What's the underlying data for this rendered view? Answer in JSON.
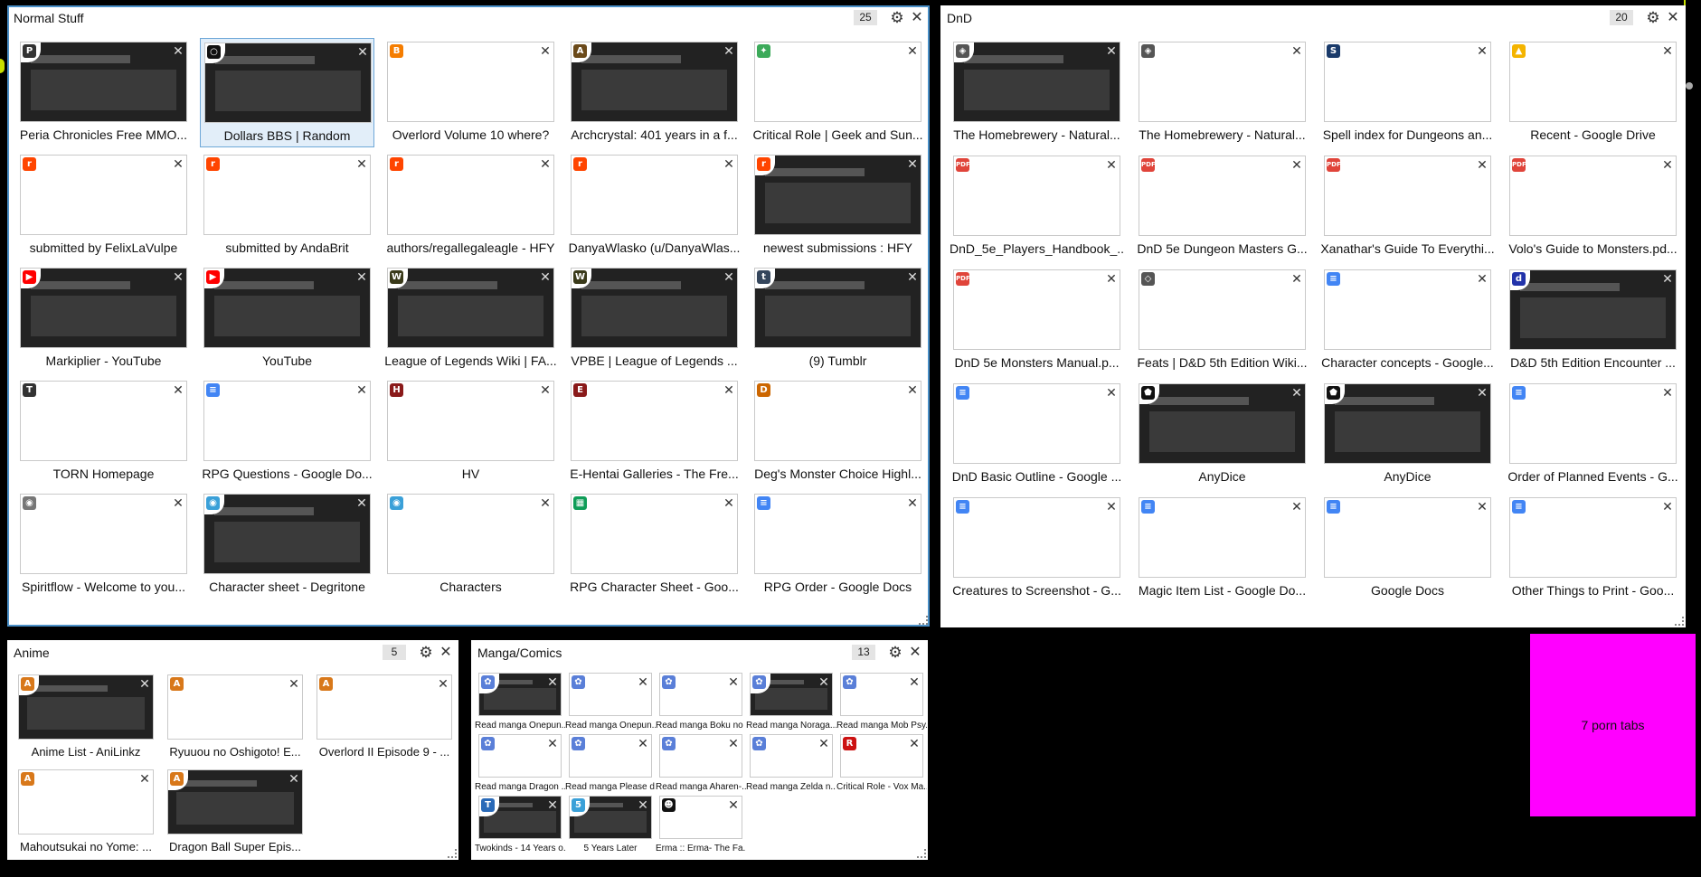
{
  "overflow_label": "7 porn tabs",
  "groups": [
    {
      "key": "normal_stuff",
      "title": "Normal Stuff",
      "count": "25",
      "tabs": [
        {
          "label": "Peria Chronicles Free MMO...",
          "icon": "page-icon",
          "icon_color": "#333333",
          "glyph": "P",
          "dark": true
        },
        {
          "label": "Dollars BBS | Random",
          "icon": "page-icon",
          "icon_color": "#111111",
          "glyph": "○",
          "dark": true,
          "selected": true
        },
        {
          "label": "Overlord Volume 10 where?",
          "icon": "blogger-icon",
          "icon_color": "#f57d00",
          "glyph": "B",
          "dark": false
        },
        {
          "label": "Archcrystal: 401 years in a f...",
          "icon": "page-icon",
          "icon_color": "#6b4a1a",
          "glyph": "A",
          "dark": true
        },
        {
          "label": "Critical Role | Geek and Sun...",
          "icon": "page-icon",
          "icon_color": "#3caa5a",
          "glyph": "✦",
          "dark": false
        },
        {
          "label": "submitted by FelixLaVulpe",
          "icon": "reddit-icon",
          "icon_color": "#ff4500",
          "glyph": "r",
          "dark": false
        },
        {
          "label": "submitted by AndaBrit",
          "icon": "reddit-icon",
          "icon_color": "#ff4500",
          "glyph": "r",
          "dark": false
        },
        {
          "label": "authors/regallegaleagle - HFY",
          "icon": "reddit-icon",
          "icon_color": "#ff4500",
          "glyph": "r",
          "dark": false
        },
        {
          "label": "DanyaWlasko (u/DanyaWlas...",
          "icon": "reddit-icon",
          "icon_color": "#ff4500",
          "glyph": "r",
          "dark": false
        },
        {
          "label": "newest submissions : HFY",
          "icon": "reddit-icon",
          "icon_color": "#ff4500",
          "glyph": "r",
          "dark": true
        },
        {
          "label": "Markiplier - YouTube",
          "icon": "youtube-icon",
          "icon_color": "#ff0000",
          "glyph": "▶",
          "dark": true
        },
        {
          "label": "YouTube",
          "icon": "youtube-icon",
          "icon_color": "#ff0000",
          "glyph": "▶",
          "dark": true
        },
        {
          "label": "League of Legends Wiki | FA...",
          "icon": "wikia-icon",
          "icon_color": "#3a3a1a",
          "glyph": "W",
          "dark": true
        },
        {
          "label": "VPBE | League of Legends ...",
          "icon": "wikia-icon",
          "icon_color": "#3a3a1a",
          "glyph": "W",
          "dark": true
        },
        {
          "label": "(9) Tumblr",
          "icon": "tumblr-icon",
          "icon_color": "#35465c",
          "glyph": "t",
          "dark": true
        },
        {
          "label": "TORN Homepage",
          "icon": "torn-icon",
          "icon_color": "#333333",
          "glyph": "T",
          "dark": false
        },
        {
          "label": "RPG Questions - Google Do...",
          "icon": "google-docs-icon",
          "icon_color": "#4285f4",
          "glyph": "≡",
          "dark": false
        },
        {
          "label": "HV",
          "icon": "page-icon",
          "icon_color": "#8a1a1a",
          "glyph": "H",
          "dark": false
        },
        {
          "label": "E-Hentai Galleries - The Fre...",
          "icon": "page-icon",
          "icon_color": "#8a1a1a",
          "glyph": "E",
          "dark": false
        },
        {
          "label": "Deg's Monster Choice Highl...",
          "icon": "page-icon",
          "icon_color": "#cc6600",
          "glyph": "D",
          "dark": false
        },
        {
          "label": "Spiritflow - Welcome to you...",
          "icon": "chat-icon",
          "icon_color": "#777777",
          "glyph": "◉",
          "dark": false
        },
        {
          "label": "Character sheet - Degritone",
          "icon": "chat-icon",
          "icon_color": "#3aa0d8",
          "glyph": "◉",
          "dark": true
        },
        {
          "label": "Characters",
          "icon": "chat-icon",
          "icon_color": "#3aa0d8",
          "glyph": "◉",
          "dark": false
        },
        {
          "label": "RPG Character Sheet - Goo...",
          "icon": "google-sheets-icon",
          "icon_color": "#0f9d58",
          "glyph": "▦",
          "dark": false
        },
        {
          "label": "RPG Order - Google Docs",
          "icon": "google-docs-icon",
          "icon_color": "#4285f4",
          "glyph": "≡",
          "dark": false
        }
      ]
    },
    {
      "key": "dnd",
      "title": "DnD",
      "count": "20",
      "tabs": [
        {
          "label": "The Homebrewery - Natural...",
          "icon": "d20-icon",
          "icon_color": "#555555",
          "glyph": "◈",
          "dark": true
        },
        {
          "label": "The Homebrewery - Natural...",
          "icon": "d20-icon",
          "icon_color": "#555555",
          "glyph": "◈",
          "dark": false
        },
        {
          "label": "Spell index for Dungeons an...",
          "icon": "page-icon",
          "icon_color": "#1a3a6a",
          "glyph": "S",
          "dark": false
        },
        {
          "label": "Recent - Google Drive",
          "icon": "google-drive-icon",
          "icon_color": "#f4b400",
          "glyph": "▲",
          "dark": false
        },
        {
          "label": "DnD_5e_Players_Handbook_...",
          "icon": "pdf-icon",
          "icon_color": "#e0443a",
          "glyph": "PDF",
          "dark": false
        },
        {
          "label": "DnD 5e Dungeon Masters G...",
          "icon": "pdf-icon",
          "icon_color": "#e0443a",
          "glyph": "PDF",
          "dark": false
        },
        {
          "label": "Xanathar's Guide To Everythi...",
          "icon": "pdf-icon",
          "icon_color": "#e0443a",
          "glyph": "PDF",
          "dark": false
        },
        {
          "label": "Volo's Guide to Monsters.pd...",
          "icon": "pdf-icon",
          "icon_color": "#e0443a",
          "glyph": "PDF",
          "dark": false
        },
        {
          "label": "DnD 5e Monsters Manual.p...",
          "icon": "pdf-icon",
          "icon_color": "#e0443a",
          "glyph": "PDF",
          "dark": false
        },
        {
          "label": "Feats | D&D 5th Edition Wiki...",
          "icon": "page-icon",
          "icon_color": "#555555",
          "glyph": "◇",
          "dark": false
        },
        {
          "label": "Character concepts - Google...",
          "icon": "google-docs-icon",
          "icon_color": "#4285f4",
          "glyph": "≡",
          "dark": false
        },
        {
          "label": "D&D 5th Edition Encounter ...",
          "icon": "page-icon",
          "icon_color": "#2233aa",
          "glyph": "d",
          "dark": true
        },
        {
          "label": "DnD Basic Outline - Google ...",
          "icon": "google-docs-icon",
          "icon_color": "#4285f4",
          "glyph": "≡",
          "dark": false
        },
        {
          "label": "AnyDice",
          "icon": "dice-icon",
          "icon_color": "#111111",
          "glyph": "⬟",
          "dark": true
        },
        {
          "label": "AnyDice",
          "icon": "dice-icon",
          "icon_color": "#111111",
          "glyph": "⬟",
          "dark": true
        },
        {
          "label": "Order of Planned Events - G...",
          "icon": "google-docs-icon",
          "icon_color": "#4285f4",
          "glyph": "≡",
          "dark": false
        },
        {
          "label": "Creatures to Screenshot - G...",
          "icon": "google-docs-icon",
          "icon_color": "#4285f4",
          "glyph": "≡",
          "dark": false
        },
        {
          "label": "Magic Item List - Google Do...",
          "icon": "google-docs-icon",
          "icon_color": "#4285f4",
          "glyph": "≡",
          "dark": false
        },
        {
          "label": "Google Docs",
          "icon": "google-docs-icon",
          "icon_color": "#4285f4",
          "glyph": "≡",
          "dark": false
        },
        {
          "label": "Other Things to Print - Goo...",
          "icon": "google-docs-icon",
          "icon_color": "#4285f4",
          "glyph": "≡",
          "dark": false
        }
      ]
    },
    {
      "key": "anime",
      "title": "Anime",
      "count": "5",
      "tabs": [
        {
          "label": "Anime List - AniLinkz",
          "icon": "anilinkz-icon",
          "icon_color": "#d8781a",
          "glyph": "A",
          "dark": true
        },
        {
          "label": "Ryuuou no Oshigoto! E...",
          "icon": "anilinkz-icon",
          "icon_color": "#d8781a",
          "glyph": "A",
          "dark": false
        },
        {
          "label": "Overlord II Episode 9 - ...",
          "icon": "anilinkz-icon",
          "icon_color": "#d8781a",
          "glyph": "A",
          "dark": false
        },
        {
          "label": "Mahoutsukai no Yome: ...",
          "icon": "anilinkz-icon",
          "icon_color": "#d8781a",
          "glyph": "A",
          "dark": false
        },
        {
          "label": "Dragon Ball Super Epis...",
          "icon": "anilinkz-icon",
          "icon_color": "#d8781a",
          "glyph": "A",
          "dark": true
        }
      ]
    },
    {
      "key": "manga",
      "title": "Manga/Comics",
      "count": "13",
      "tabs": [
        {
          "label": "Read manga Onepun...",
          "icon": "manga-icon",
          "icon_color": "#5a7fd8",
          "glyph": "✿",
          "dark": true
        },
        {
          "label": "Read manga Onepun...",
          "icon": "manga-icon",
          "icon_color": "#5a7fd8",
          "glyph": "✿",
          "dark": false
        },
        {
          "label": "Read manga Boku no ...",
          "icon": "manga-icon",
          "icon_color": "#5a7fd8",
          "glyph": "✿",
          "dark": false
        },
        {
          "label": "Read manga Noraga...",
          "icon": "manga-icon",
          "icon_color": "#5a7fd8",
          "glyph": "✿",
          "dark": true
        },
        {
          "label": "Read manga Mob Psy...",
          "icon": "manga-icon",
          "icon_color": "#5a7fd8",
          "glyph": "✿",
          "dark": false
        },
        {
          "label": "Read manga Dragon ...",
          "icon": "manga-icon",
          "icon_color": "#5a7fd8",
          "glyph": "✿",
          "dark": false
        },
        {
          "label": "Read manga Please d...",
          "icon": "manga-icon",
          "icon_color": "#5a7fd8",
          "glyph": "✿",
          "dark": false
        },
        {
          "label": "Read manga Aharen-...",
          "icon": "manga-icon",
          "icon_color": "#5a7fd8",
          "glyph": "✿",
          "dark": false
        },
        {
          "label": "Read manga Zelda n...",
          "icon": "manga-icon",
          "icon_color": "#5a7fd8",
          "glyph": "✿",
          "dark": false
        },
        {
          "label": "Critical Role - Vox Ma...",
          "icon": "roosterteeth-icon",
          "icon_color": "#cc1111",
          "glyph": "R",
          "dark": false
        },
        {
          "label": "Twokinds - 14 Years o...",
          "icon": "twokinds-icon",
          "icon_color": "#2a6ab8",
          "glyph": "T",
          "dark": true
        },
        {
          "label": "5 Years Later",
          "icon": "page-icon",
          "icon_color": "#3aa0d8",
          "glyph": "5",
          "dark": true
        },
        {
          "label": "Erma :: Erma- The Fa...",
          "icon": "erma-icon",
          "icon_color": "#111111",
          "glyph": "☻",
          "dark": false
        }
      ]
    }
  ]
}
